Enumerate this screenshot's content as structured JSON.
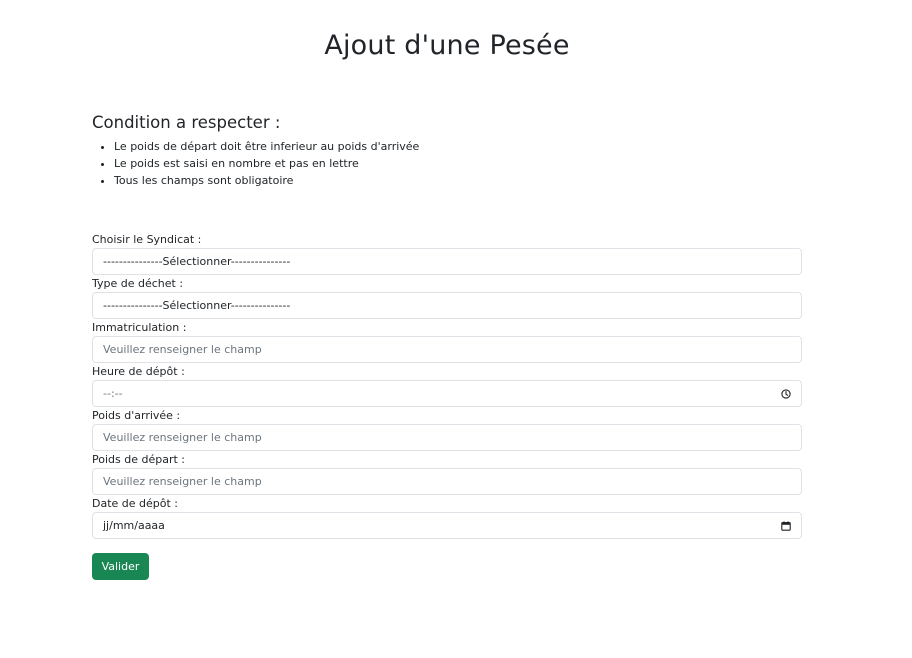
{
  "header": {
    "title": "Ajout d'une Pesée"
  },
  "conditions": {
    "heading": "Condition a respecter :",
    "items": [
      "Le poids de départ doit être inferieur au poids d'arrivée",
      "Le poids est saisi en nombre et pas en lettre",
      "Tous les champs sont obligatoire"
    ]
  },
  "form": {
    "syndicat": {
      "label": "Choisir le Syndicat :",
      "selected": "---------------Sélectionner---------------"
    },
    "type_dechet": {
      "label": "Type de déchet :",
      "selected": "---------------Sélectionner---------------"
    },
    "immatriculation": {
      "label": "Immatriculation :",
      "placeholder": "Veuillez renseigner le champ"
    },
    "heure_depot": {
      "label": "Heure de dépôt :",
      "value": "--:--",
      "icon": "clock-icon"
    },
    "poids_arrivee": {
      "label": "Poids d'arrivée :",
      "placeholder": "Veuillez renseigner le champ"
    },
    "poids_depart": {
      "label": "Poids de départ :",
      "placeholder": "Veuillez renseigner le champ"
    },
    "date_depot": {
      "label": "Date de dépôt :",
      "value": "jj/mm/aaaa",
      "icon": "calendar-icon"
    },
    "submit_label": "Valider"
  },
  "colors": {
    "submit_bg": "#198754",
    "border": "#dee2e6",
    "placeholder": "#6c757d"
  }
}
